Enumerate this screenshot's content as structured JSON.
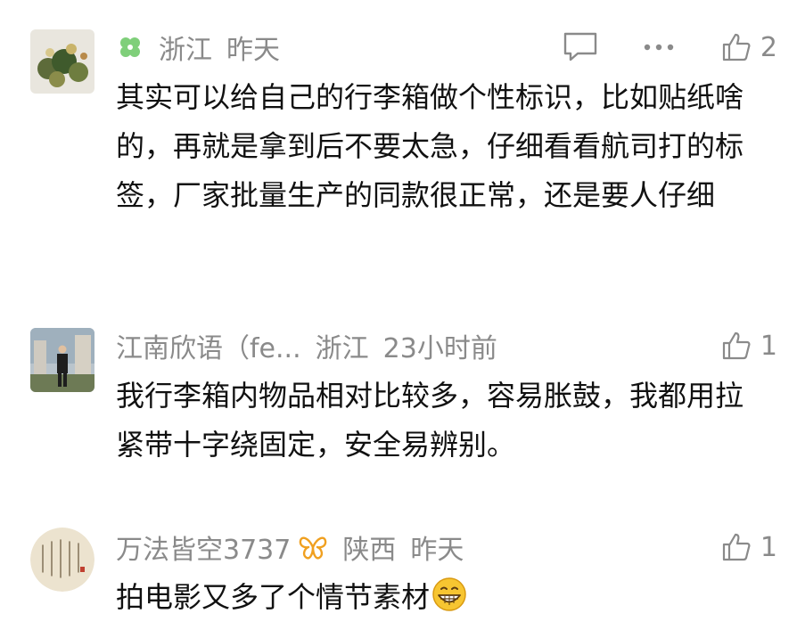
{
  "comments": [
    {
      "location": "浙江",
      "time": "昨天",
      "likes": "2",
      "text": "其实可以给自己的行李箱做个性标识，比如贴纸啥的，再就是拿到后不要太急，仔细看看航司打的标签，厂家批量生产的同款很正常，还是要人仔细",
      "badge_icon": "clover-icon"
    },
    {
      "username": "江南欣语（fe...",
      "location": "浙江",
      "time": "23小时前",
      "likes": "1",
      "text": "我行李箱内物品相对比较多，容易胀鼓，我都用拉紧带十字绕固定，安全易辨别。"
    },
    {
      "username": "万法皆空3737",
      "location": "陕西",
      "time": "昨天",
      "likes": "1",
      "text": "拍电影又多了个情节素材",
      "badge_icon": "butterfly-icon",
      "trailing_emoji": "grinning-face-emoji"
    }
  ],
  "colors": {
    "meta_text": "#8a8a8a",
    "body_text": "#111111",
    "clover": "#7fcf7a",
    "butterfly": "#f0a020"
  }
}
